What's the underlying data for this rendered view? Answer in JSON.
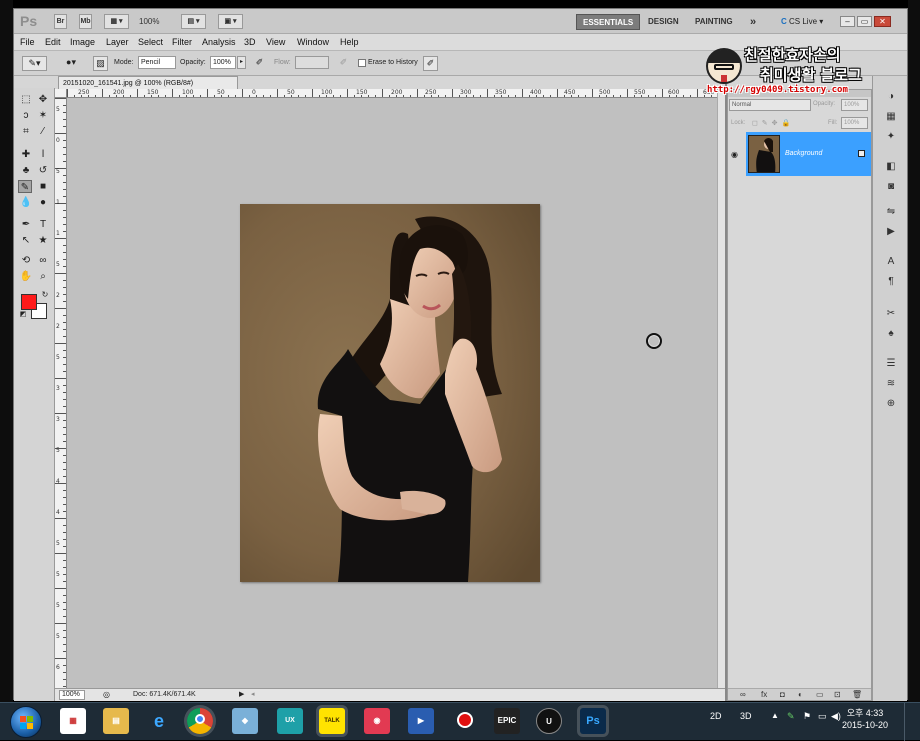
{
  "app": {
    "logo": "Ps",
    "bridge_label": "Br",
    "minibridge_label": "Mb",
    "zoom_text": "100%",
    "workspaces": [
      "ESSENTIALS",
      "DESIGN",
      "PAINTING"
    ],
    "active_workspace": "ESSENTIALS",
    "more_label": "»",
    "cs_live": "CS Live"
  },
  "menu": [
    "File",
    "Edit",
    "Image",
    "Layer",
    "Select",
    "Filter",
    "Analysis",
    "3D",
    "View",
    "Window",
    "Help"
  ],
  "options": {
    "mode_label": "Mode:",
    "mode_value": "Pencil",
    "opacity_label": "Opacity:",
    "opacity_value": "100%",
    "flow_label": "Flow:",
    "flow_value": "",
    "erase_to_history": "Erase to History"
  },
  "document": {
    "tab_title": "20151020_161541.jpg @ 100% (RGB/8#)",
    "status_zoom": "100%",
    "status_doc": "Doc: 671.4K/671.4K"
  },
  "rulers": {
    "top": [
      "250",
      "200",
      "150",
      "100",
      "50",
      "0",
      "50",
      "100",
      "150",
      "200",
      "250",
      "300",
      "350",
      "400",
      "450",
      "500",
      "550",
      "600",
      "650"
    ],
    "left": [
      "5",
      "0",
      "5",
      "1",
      "1",
      "5",
      "2",
      "2",
      "5",
      "3",
      "3",
      "5",
      "4",
      "4",
      "5",
      "5",
      "5",
      "5",
      "6"
    ]
  },
  "colors": {
    "foreground": "#fe1a1a",
    "background": "#ffffff",
    "layer_highlight": "#3ba0ff",
    "canvas_bg": "#c0c0c0"
  },
  "layers_panel": {
    "blend_mode": "Normal",
    "opacity_label": "Opacity:",
    "opacity_value": "100%",
    "lock_label": "Lock:",
    "fill_label": "Fill:",
    "fill_value": "100%",
    "layer_name": "Background"
  },
  "watermark": {
    "line1": "친절한효자손의",
    "line2": "취미생활 블로그",
    "url": "http://rgy0409.tistory.com"
  },
  "taskbar": {
    "ime_2d": "2D",
    "ime_3d": "3D",
    "clock_time": "오후 4:33",
    "clock_date": "2015-10-20",
    "apps": [
      "windows-media",
      "explorer",
      "internet-explorer",
      "chrome",
      "pen-app",
      "studio-ux",
      "kakaotalk",
      "camera-app",
      "media-player",
      "record",
      "epic-games",
      "unreal-engine",
      "photoshop"
    ]
  }
}
